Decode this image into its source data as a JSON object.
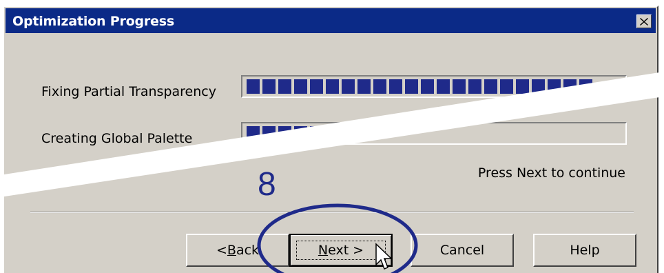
{
  "window": {
    "title": "Optimization Progress",
    "close_label": "Close"
  },
  "tasks": [
    {
      "label": "Fixing Partial Transparency",
      "progress": 1.0
    },
    {
      "label": "Creating Global Palette",
      "progress": 0.35
    }
  ],
  "status_text": "Press Next to continue",
  "buttons": {
    "back": {
      "prefix": "< ",
      "accel": "B",
      "rest": "ack"
    },
    "next": {
      "accel": "N",
      "rest": "ext >"
    },
    "cancel": "Cancel",
    "help": "Help"
  },
  "annotation": {
    "step_number": "8",
    "color": "#1f2a8a"
  },
  "colors": {
    "titlebar": "#0b2a87",
    "progress_block": "#1f2a8a",
    "face": "#d4d0c8"
  }
}
